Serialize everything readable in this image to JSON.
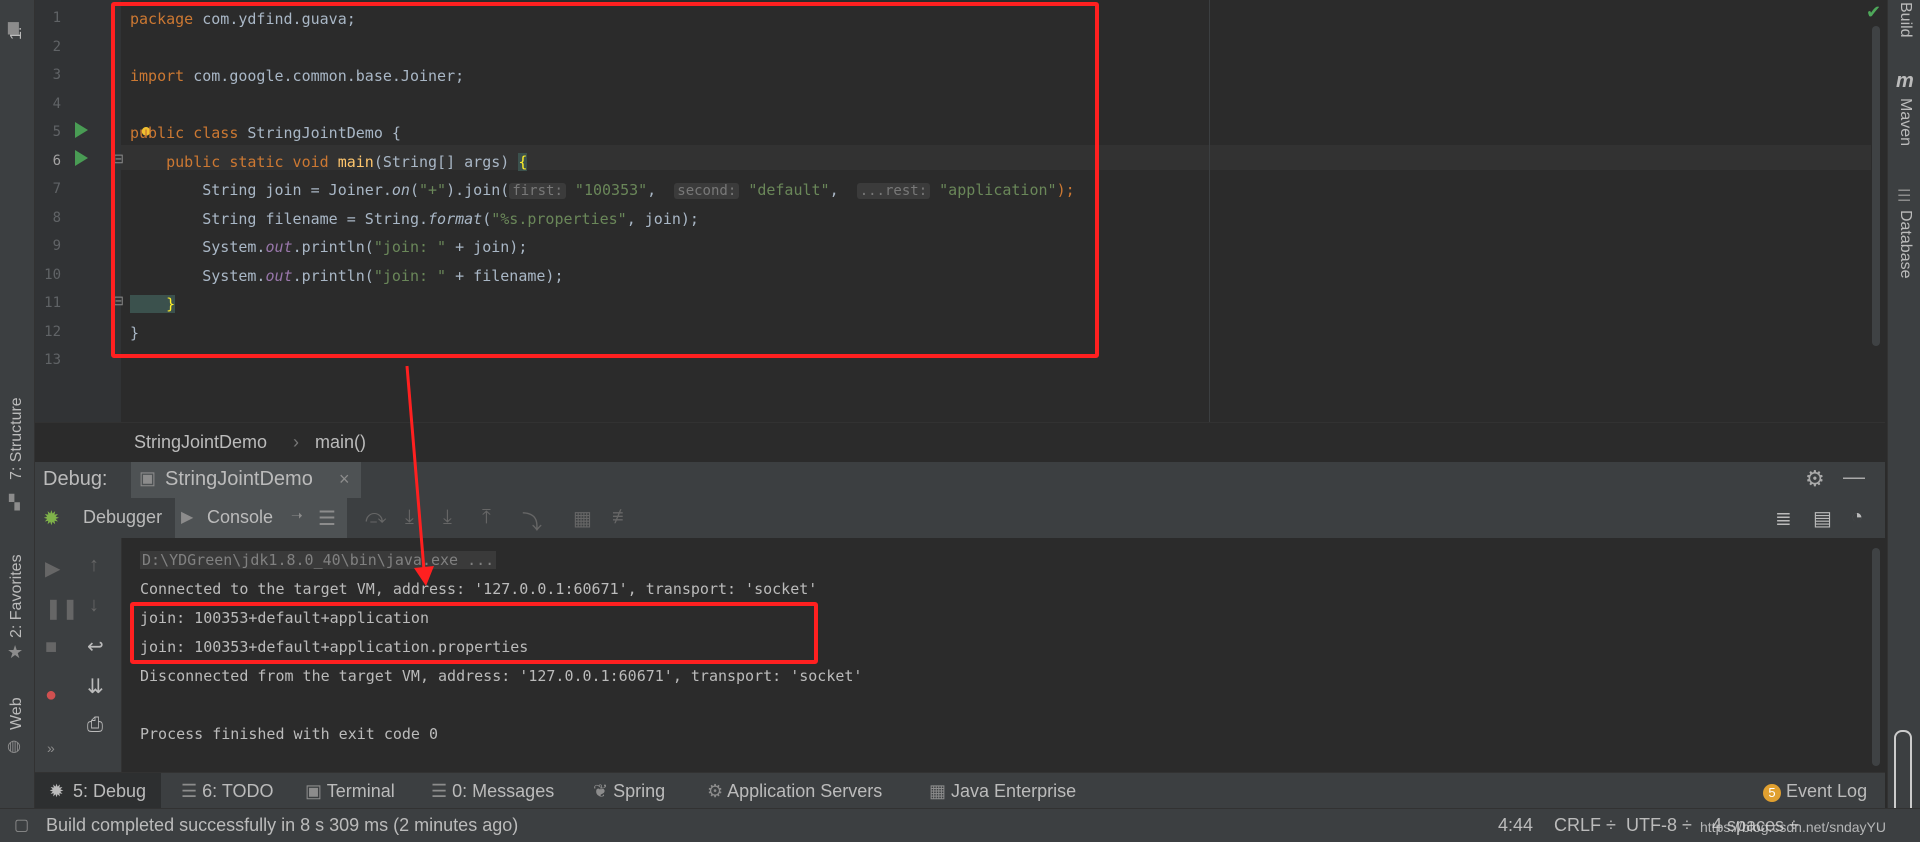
{
  "left_strip": {
    "project": "1:",
    "structure": "7: Structure",
    "favorites": "2: Favorites",
    "web": "Web"
  },
  "right_strip": {
    "build": "Build",
    "maven": "Maven",
    "database": "Database"
  },
  "editor": {
    "line_numbers": [
      "1",
      "2",
      "3",
      "4",
      "5",
      "6",
      "7",
      "8",
      "9",
      "10",
      "11",
      "12",
      "13"
    ],
    "code": {
      "l1_kw": "package",
      "l1_rest": " com.ydfind.guava;",
      "l3_kw": "import",
      "l3_rest": " com.google.common.base.Joiner;",
      "l5_kw": "public class",
      "l5_rest": " StringJointDemo {",
      "l6_kw": "    public static void ",
      "l6_m": "main",
      "l6_rest": "(String[] args) ",
      "l6_brace": "{",
      "l7_a": "        String join = Joiner.",
      "l7_on": "on",
      "l7_b": "(",
      "l7_plus": "\"+\"",
      "l7_c": ").join(",
      "l7_h1": "first:",
      "l7_s1": "\"100353\"",
      "l7_h2": "second:",
      "l7_s2": "\"default\"",
      "l7_h3": "...rest:",
      "l7_s3": "\"application\"",
      "l7_end": ");",
      "l8_a": "        String filename = String.",
      "l8_f": "format",
      "l8_b": "(",
      "l8_s": "\"%s.properties\"",
      "l8_c": ", join);",
      "l9_a": "        System.",
      "l9_out": "out",
      "l9_b": ".println(",
      "l9_s": "\"join: \"",
      "l9_c": " + join);",
      "l10_a": "        System.",
      "l10_out": "out",
      "l10_b": ".println(",
      "l10_s": "\"join: \"",
      "l10_c": " + filename);",
      "l11": "    }",
      "l12": "}"
    }
  },
  "breadcrumb": {
    "class": "StringJointDemo",
    "sep": "›",
    "method": "main()"
  },
  "debug": {
    "label": "Debug:",
    "tab": "StringJointDemo",
    "debugger_tab": "Debugger",
    "console_tab": "Console",
    "console_lines": [
      "D:\\YDGreen\\jdk1.8.0_40\\bin\\java.exe ...",
      "Connected to the target VM, address: '127.0.0.1:60671', transport: 'socket'",
      "join: 100353+default+application",
      "join: 100353+default+application.properties",
      "Disconnected from the target VM, address: '127.0.0.1:60671', transport: 'socket'",
      "",
      "Process finished with exit code 0"
    ]
  },
  "tool_windows": {
    "debug": "5: Debug",
    "todo": "6: TODO",
    "terminal": "Terminal",
    "messages": "0: Messages",
    "spring": "Spring",
    "app_servers": "Application Servers",
    "java_enterprise": "Java Enterprise",
    "event_log": "Event Log",
    "event_count": "5"
  },
  "status": {
    "message": "Build completed successfully in 8 s 309 ms (2 minutes ago)",
    "position": "4:44",
    "line_sep": "CRLF ÷",
    "encoding": "UTF-8 ÷",
    "indent": "4 spaces ÷",
    "watermark": "https://blog.csdn.net/sndayYU"
  },
  "colors": {
    "keyword": "#cc7832",
    "string": "#6a8759",
    "annotation": "#ff2020",
    "run": "#499c54"
  }
}
